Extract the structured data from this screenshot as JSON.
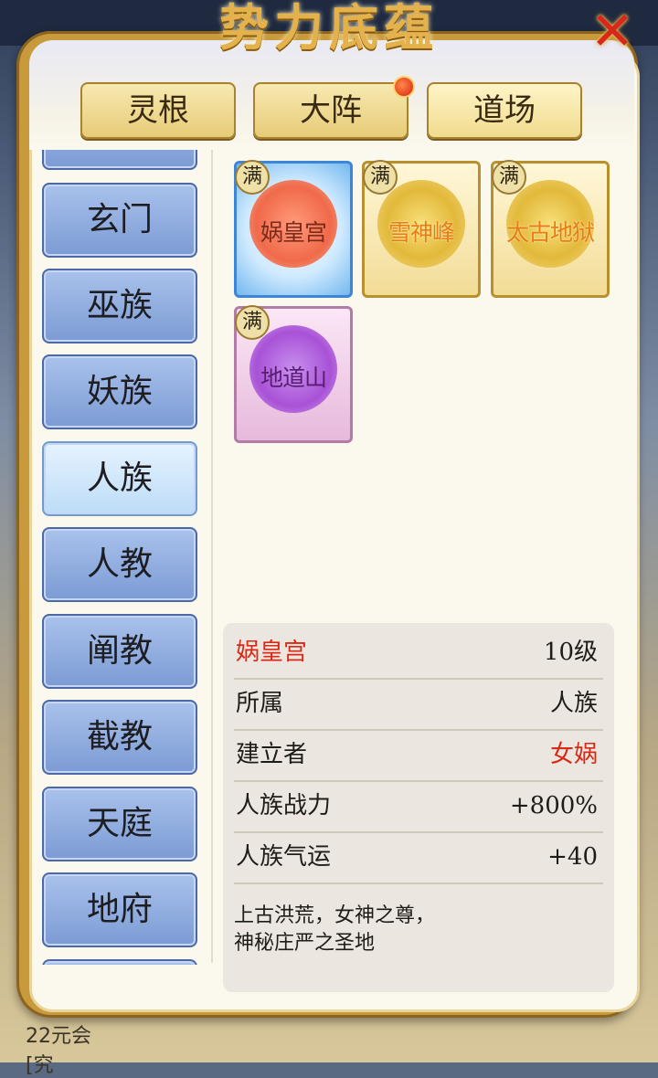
{
  "title": "势力底蕴",
  "top_tabs": [
    {
      "label": "灵根",
      "active": false,
      "badge": false
    },
    {
      "label": "大阵",
      "active": false,
      "badge": true
    },
    {
      "label": "道场",
      "active": true,
      "badge": false
    }
  ],
  "sidebar": {
    "items": [
      {
        "label": "",
        "active": false
      },
      {
        "label": "玄门",
        "active": false
      },
      {
        "label": "巫族",
        "active": false
      },
      {
        "label": "妖族",
        "active": false
      },
      {
        "label": "人族",
        "active": true
      },
      {
        "label": "人教",
        "active": false
      },
      {
        "label": "阐教",
        "active": false
      },
      {
        "label": "截教",
        "active": false
      },
      {
        "label": "天庭",
        "active": false
      },
      {
        "label": "地府",
        "active": false
      },
      {
        "label": "",
        "active": false
      }
    ]
  },
  "sites": [
    {
      "name": "娲皇宫",
      "badge": "满",
      "style": "blue"
    },
    {
      "name": "雪神峰",
      "badge": "满",
      "style": "gold"
    },
    {
      "name": "太古地狱",
      "badge": "满",
      "style": "gold"
    },
    {
      "name": "地道山",
      "badge": "满",
      "style": "purple"
    }
  ],
  "detail": {
    "name": "娲皇宫",
    "level": "10级",
    "rows": [
      {
        "key": "所属",
        "value": "人族",
        "highlight": false
      },
      {
        "key": "建立者",
        "value": "女娲",
        "highlight": true
      },
      {
        "key": "人族战力",
        "value": "+800%",
        "highlight": false
      },
      {
        "key": "人族气运",
        "value": "+40",
        "highlight": false
      }
    ],
    "description_line1": "上古洪荒，女神之尊，",
    "description_line2": "神秘庄严之圣地"
  },
  "background_text": {
    "line1": "22元会",
    "line2": "[究"
  },
  "colors": {
    "accent_red": "#d92a18",
    "sidebar_blue": "#7c9bd4",
    "gold_frame": "#c99a3c"
  }
}
